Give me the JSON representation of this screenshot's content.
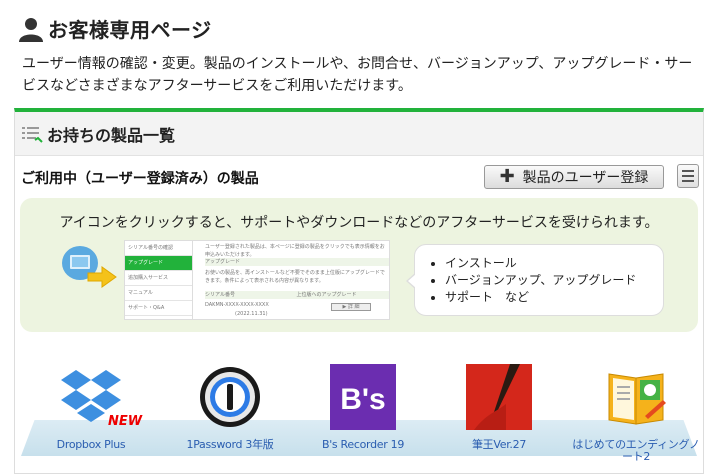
{
  "header": {
    "title": "お客様専用ページ",
    "intro": "ユーザー情報の確認・変更。製品のインストールや、お問合せ、バージョンアップ、アップグレード・サービスなどさまざまなアフターサービスをご利用いただけます。"
  },
  "panel": {
    "title": "お持ちの製品一覧",
    "subtitle": "ご利用中（ユーザー登録済み）の製品",
    "register_label": "製品のユーザー登録",
    "info": {
      "lead": "アイコンをクリックすると、サポートやダウンロードなどのアフターサービスを受けられます。",
      "preview": {
        "nav": [
          "シリアル番号の確認",
          "アップグレード",
          "追加購入サービス",
          "マニュアル",
          "サポート・Q&A"
        ],
        "text_1": "ユーザー登録された製品は、本ページに登録の製品をクリックでも表示情報をお申込みいただけます。",
        "section": "アップグレード",
        "text_2": "お使いの製品を、再インストールなど不要でそのまま上位版にアップグレードできます。条件によって表示される内容が異なります。",
        "serial_label": "シリアル番号",
        "upgrade_link": "上位版へのアップグレード",
        "serial_value": "DAKMN-XXXX-XXXX-XXXX",
        "date": "(2022.11.31)",
        "detail_button": "▶ 詳 細"
      },
      "bullets": [
        "インストール",
        "バージョンアップ、アップグレード",
        "サポート　など"
      ]
    },
    "products": [
      {
        "name": "Dropbox Plus",
        "badge": "NEW"
      },
      {
        "name": "1Password 3年版"
      },
      {
        "name": "B's Recorder 19",
        "logo_text": "B's"
      },
      {
        "name": "筆王Ver.27"
      },
      {
        "name": "はじめてのエンディングノート2"
      }
    ]
  },
  "colors": {
    "accent": "#22b23b",
    "link": "#2a5db0",
    "info_bg": "#edf4e0",
    "badge": "#e00000"
  }
}
